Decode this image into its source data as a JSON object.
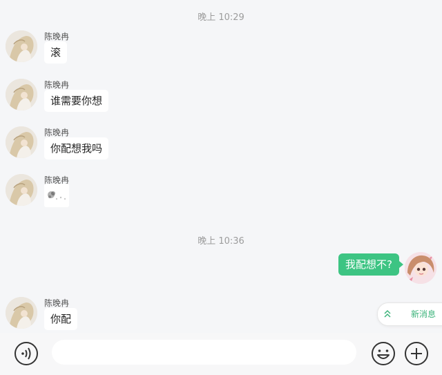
{
  "chat": {
    "timestamps": [
      "晚上 10:29",
      "晚上 10:36"
    ],
    "incoming": [
      {
        "sender": "陈晚冉",
        "text": "滚"
      },
      {
        "sender": "陈晚冉",
        "text": "谁需要你想"
      },
      {
        "sender": "陈晚冉",
        "text": "你配想我吗"
      },
      {
        "sender": "陈晚冉",
        "text": ""
      },
      {
        "sender": "陈晚冉",
        "text": "你配"
      }
    ],
    "outgoing": [
      {
        "text": "我配想不?"
      }
    ]
  },
  "new_messages": {
    "label": "新消息"
  },
  "input_bar": {
    "placeholder": ""
  },
  "icons": {
    "voice": "voice-wave-icon",
    "emoji": "emoji-smile-icon",
    "plus": "add-plus-icon",
    "chevron": "double-chevron-up-icon"
  },
  "colors": {
    "sent_bubble": "#3dc483",
    "received_bubble": "#ffffff",
    "background": "#f5f6f8",
    "accent": "#3bb37a"
  }
}
